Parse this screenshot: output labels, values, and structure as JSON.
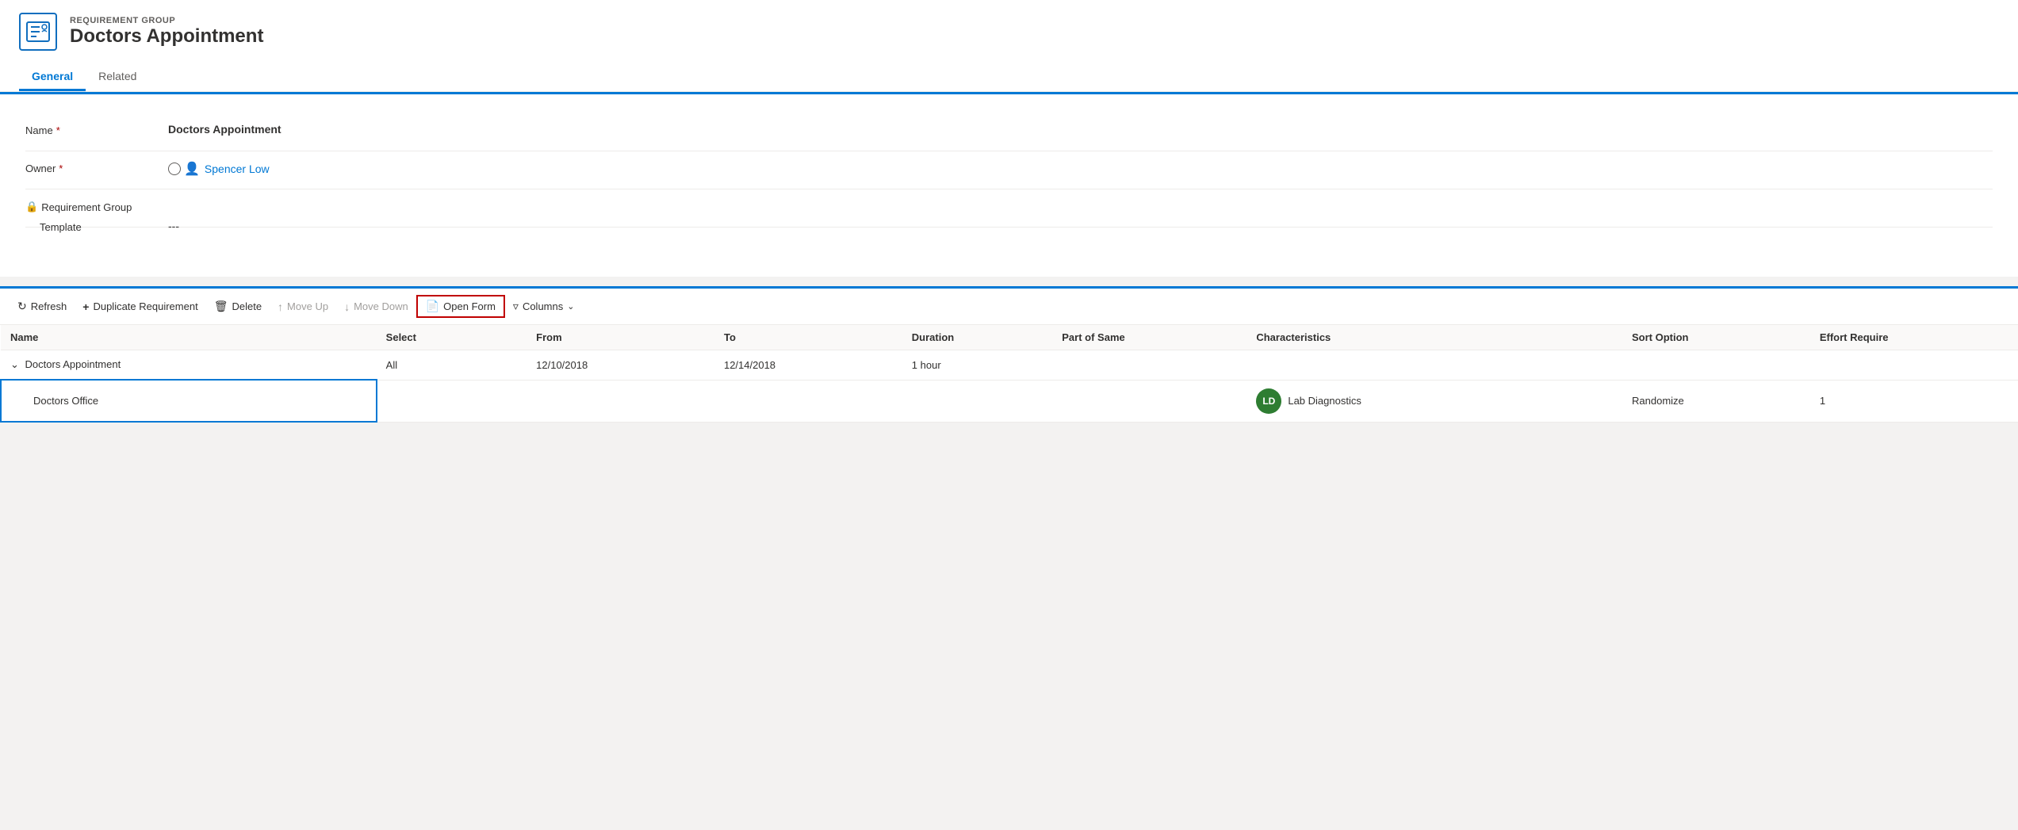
{
  "header": {
    "subtitle": "REQUIREMENT GROUP",
    "title": "Doctors Appointment",
    "icon_label": "RG"
  },
  "tabs": [
    {
      "id": "general",
      "label": "General",
      "active": true
    },
    {
      "id": "related",
      "label": "Related",
      "active": false
    }
  ],
  "form": {
    "fields": [
      {
        "id": "name",
        "label": "Name",
        "required": true,
        "locked": false,
        "value": "Doctors Appointment",
        "bold": true
      },
      {
        "id": "owner",
        "label": "Owner",
        "required": true,
        "locked": false,
        "value": "Spencer Low",
        "is_owner": true
      },
      {
        "id": "requirement_group_template",
        "label": "Requirement Group Template",
        "required": false,
        "locked": true,
        "value": "---"
      }
    ]
  },
  "toolbar": {
    "refresh_label": "Refresh",
    "duplicate_label": "Duplicate Requirement",
    "delete_label": "Delete",
    "move_up_label": "Move Up",
    "move_down_label": "Move Down",
    "open_form_label": "Open Form",
    "columns_label": "Columns"
  },
  "table": {
    "columns": [
      {
        "id": "name",
        "label": "Name"
      },
      {
        "id": "select",
        "label": "Select"
      },
      {
        "id": "from",
        "label": "From"
      },
      {
        "id": "to",
        "label": "To"
      },
      {
        "id": "duration",
        "label": "Duration"
      },
      {
        "id": "part_of_same",
        "label": "Part of Same"
      },
      {
        "id": "characteristics",
        "label": "Characteristics"
      },
      {
        "id": "sort_option",
        "label": "Sort Option"
      },
      {
        "id": "effort_required",
        "label": "Effort Require"
      }
    ],
    "rows": [
      {
        "id": "row1",
        "indent": false,
        "has_chevron": true,
        "name": "Doctors Appointment",
        "select": "All",
        "from": "12/10/2018",
        "to": "12/14/2018",
        "duration": "1 hour",
        "part_of_same": "",
        "characteristics": "",
        "characteristics_avatar": "",
        "sort_option": "",
        "effort_required": "",
        "selected": false
      },
      {
        "id": "row2",
        "indent": true,
        "has_chevron": false,
        "name": "Doctors Office",
        "select": "",
        "from": "",
        "to": "",
        "duration": "",
        "part_of_same": "",
        "characteristics": "Lab Diagnostics",
        "characteristics_avatar": "LD",
        "sort_option": "Randomize",
        "effort_required": "1",
        "selected": true
      }
    ]
  }
}
